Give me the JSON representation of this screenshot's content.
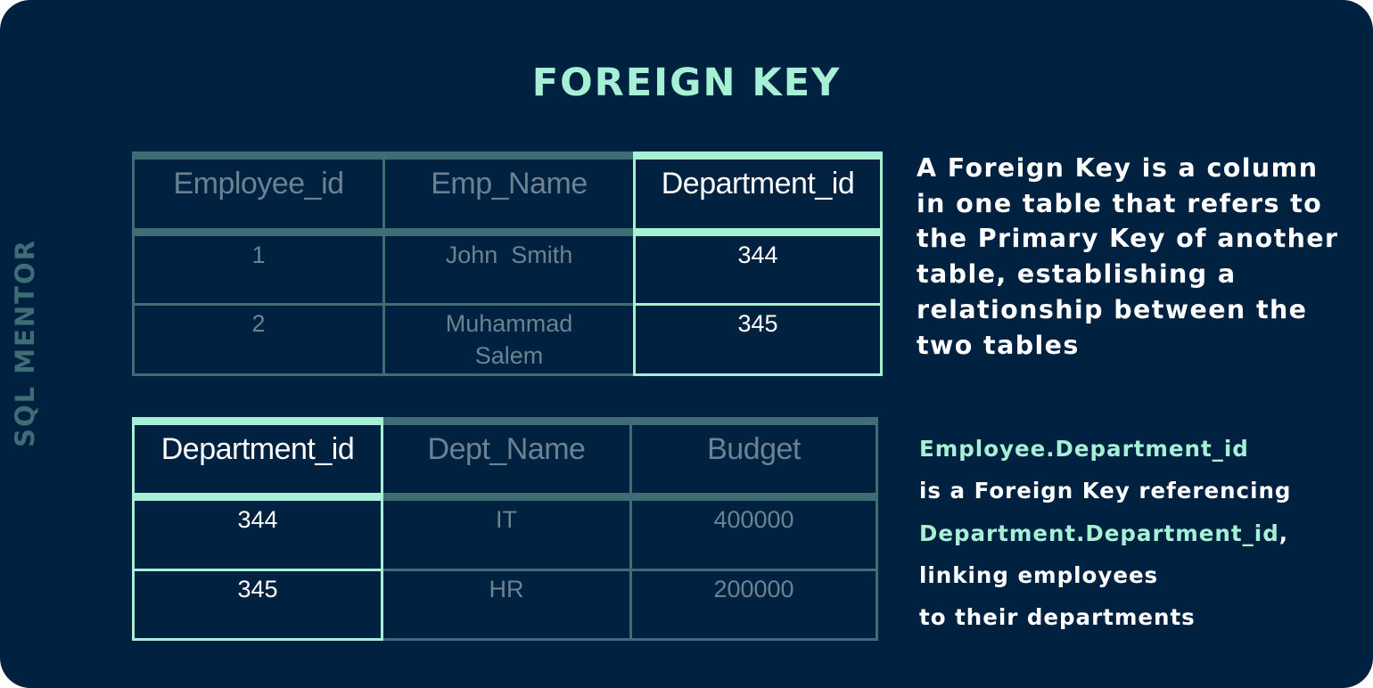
{
  "title": "FOREIGN KEY",
  "side_brand": "SQL MENTOR",
  "employee_table": {
    "headers": [
      "Employee_id",
      "Emp_Name",
      "Department_id"
    ],
    "rows": [
      [
        "1",
        "John  Smith",
        "344"
      ],
      [
        "2",
        "Muhammad Salem",
        "345"
      ]
    ]
  },
  "department_table": {
    "headers": [
      "Department_id",
      "Dept_Name",
      "Budget"
    ],
    "rows": [
      [
        "344",
        "IT",
        "400000"
      ],
      [
        "345",
        "HR",
        "200000"
      ]
    ]
  },
  "description": "A Foreign Key is a column in one table that refers to the Primary Key of another table, establishing a relationship between the two tables",
  "note": {
    "ref_from": "Employee.Department_id",
    "middle": "is a Foreign Key referencing",
    "ref_to": "Department.Department_id",
    "ref_to_suffix": ",",
    "tail_1": "linking employees",
    "tail_2": "to their departments"
  },
  "colors": {
    "background": "#002240",
    "accent_mint": "#a6f0d5",
    "grid_dim": "#3e6d76",
    "text_dim": "#6b8293",
    "text_light": "#ffffff"
  }
}
